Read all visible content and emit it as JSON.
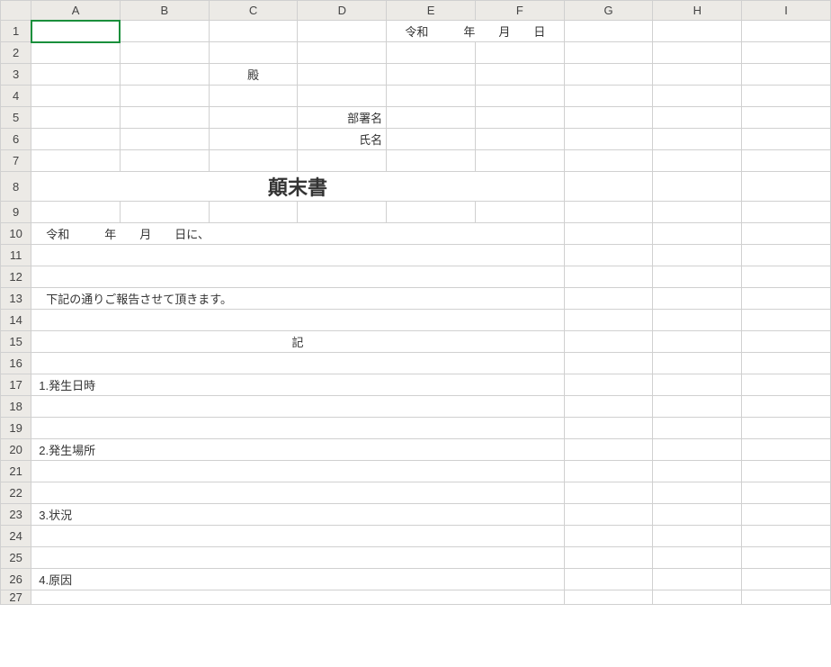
{
  "columns": [
    "A",
    "B",
    "C",
    "D",
    "E",
    "F",
    "G",
    "H",
    "I"
  ],
  "rows": [
    "1",
    "2",
    "3",
    "4",
    "5",
    "6",
    "7",
    "8",
    "9",
    "10",
    "11",
    "12",
    "13",
    "14",
    "15",
    "16",
    "17",
    "18",
    "19",
    "20",
    "21",
    "22",
    "23",
    "24",
    "25",
    "26",
    "27"
  ],
  "cells": {
    "r1_ef": "令和　　　年　　月　　日",
    "r3_c": "殿",
    "r5_d": "部署名",
    "r6_d": "氏名",
    "r8_title": "顛末書",
    "r10": "令和　　　年　　月　　日に、",
    "r13": "下記の通りご報告させて頂きます。",
    "r15": "記",
    "r17": "1.発生日時",
    "r20": "2.発生場所",
    "r23": "3.状況",
    "r26": "4.原因"
  }
}
